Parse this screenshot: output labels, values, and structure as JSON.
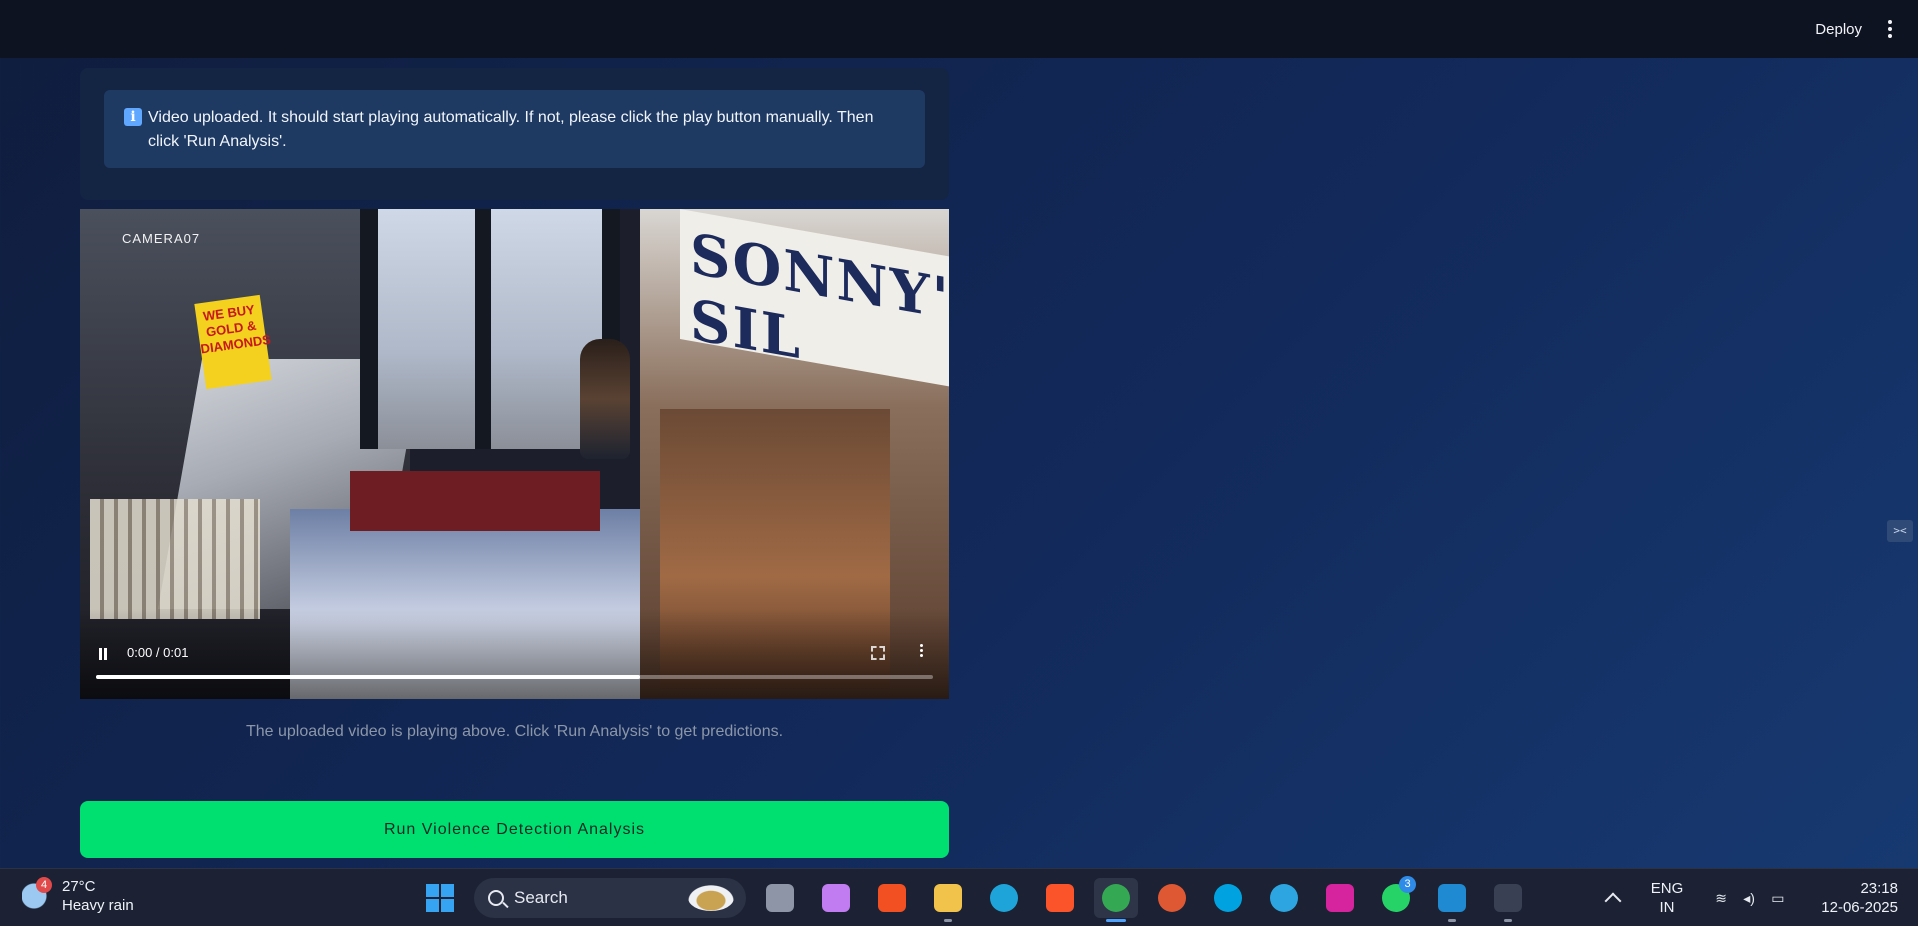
{
  "header": {
    "deploy_label": "Deploy"
  },
  "alert": {
    "message": "Video uploaded. It should start playing automatically. If not, please click the play button manually. Then click 'Run Analysis'."
  },
  "video": {
    "camera_label": "CAMERA07",
    "sign_text": "SONNY'S SIL",
    "gold_sign_text": "WE BUY GOLD & DIAMONDS",
    "time_display": "0:00 / 0:01",
    "progress_fraction": 0.65
  },
  "caption": "The uploaded video is playing above. Click 'Run Analysis' to get predictions.",
  "run_button_label": "Run Violence Detection Analysis",
  "taskbar": {
    "weather": {
      "badge": "4",
      "temperature": "27°C",
      "condition": "Heavy rain"
    },
    "search_label": "Search",
    "apps": [
      {
        "name": "task-view",
        "color": "#8e95a6"
      },
      {
        "name": "copilot",
        "color": "#c07cf0"
      },
      {
        "name": "microsoft-store",
        "color": "#f25022"
      },
      {
        "name": "file-explorer",
        "color": "#f2c34b"
      },
      {
        "name": "edge",
        "color": "#1fa4d9"
      },
      {
        "name": "brave",
        "color": "#fb542b"
      },
      {
        "name": "chrome",
        "color": "#34a853"
      },
      {
        "name": "duckduckgo",
        "color": "#de5833"
      },
      {
        "name": "alexa",
        "color": "#00a3e0"
      },
      {
        "name": "telegram",
        "color": "#2ca5e0"
      },
      {
        "name": "instagram",
        "color": "#d6249f"
      },
      {
        "name": "whatsapp",
        "color": "#25d366",
        "badge": "3"
      },
      {
        "name": "vscode",
        "color": "#1f8ad2"
      },
      {
        "name": "terminal",
        "color": "#3a4054"
      }
    ],
    "language": {
      "line1": "ENG",
      "line2": "IN"
    },
    "clock": {
      "time": "23:18",
      "date": "12-06-2025"
    }
  }
}
